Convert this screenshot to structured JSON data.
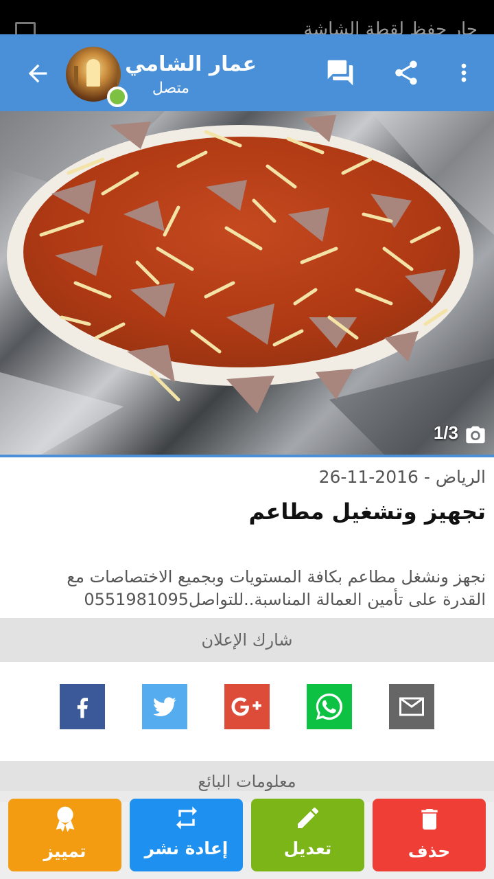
{
  "status_bar": {
    "ticker": "جار حفظ لقطة الشاشة"
  },
  "header": {
    "user_name": "عمار الشامي",
    "user_status": "متصل",
    "icons": [
      "back-arrow-icon",
      "chat-icon",
      "share-icon",
      "more-vert-icon"
    ],
    "accent": "#4a90d9"
  },
  "gallery": {
    "counter": "1/3",
    "icon": "camera-icon"
  },
  "listing": {
    "location": "الرياض",
    "date": "2016-11-26",
    "meta": "الرياض -  2016-11-26",
    "title": "تجهيز وتشغيل مطاعم",
    "description": "نجهز ونشغل مطاعم بكافة المستويات وبجميع الاختصاصات مع القدرة على تأمين العمالة المناسبة..للتواصل0551981095"
  },
  "share": {
    "header": "شارك الإعلان",
    "buttons": [
      {
        "name": "facebook",
        "icon": "facebook-icon",
        "color": "#3b5998"
      },
      {
        "name": "twitter",
        "icon": "twitter-icon",
        "color": "#55acee"
      },
      {
        "name": "google-plus",
        "icon": "google-plus-icon",
        "color": "#dd4b39"
      },
      {
        "name": "whatsapp",
        "icon": "whatsapp-icon",
        "color": "#0dc143"
      },
      {
        "name": "email",
        "icon": "mail-icon",
        "color": "#666666"
      }
    ]
  },
  "seller": {
    "header": "معلومات البائع"
  },
  "actions": [
    {
      "label": "تمييز",
      "icon": "award-icon",
      "color": "#f39c12"
    },
    {
      "label": "إعادة نشر",
      "icon": "repost-icon",
      "color": "#1e90ef"
    },
    {
      "label": "تعديل",
      "icon": "edit-pencil-icon",
      "color": "#7cb518"
    },
    {
      "label": "حذف",
      "icon": "trash-icon",
      "color": "#ef3e36"
    }
  ]
}
